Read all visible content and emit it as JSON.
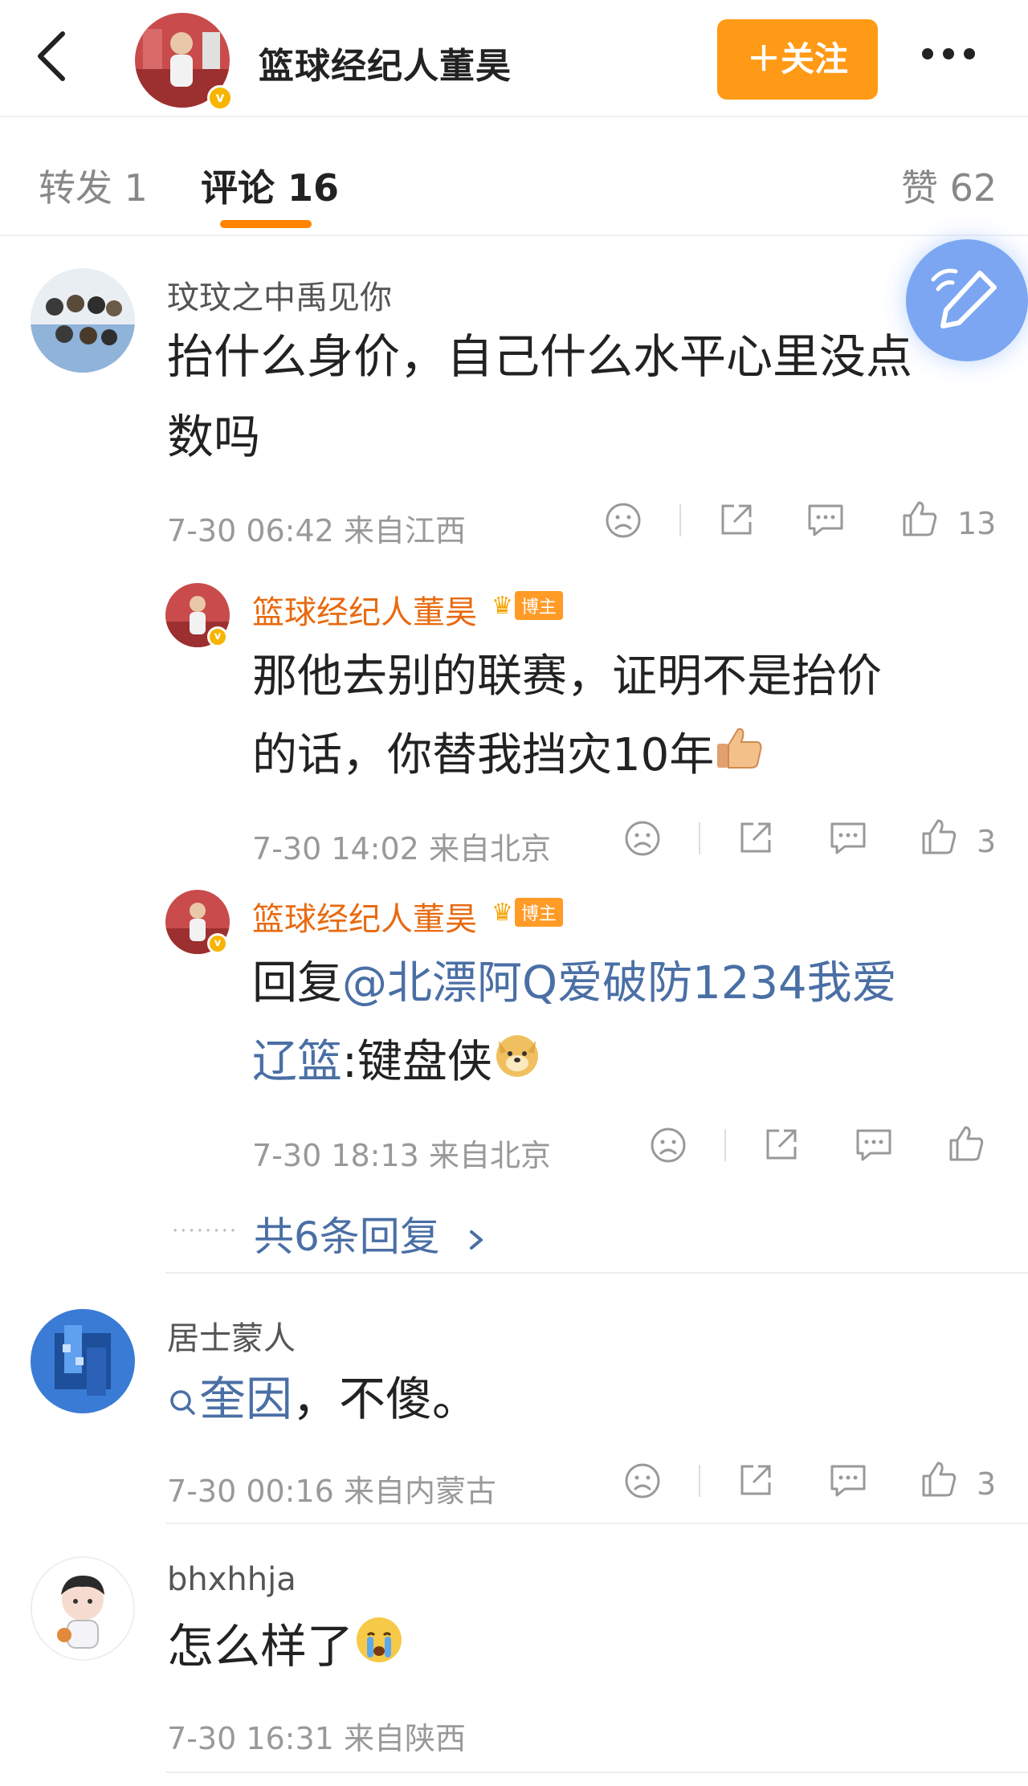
{
  "header": {
    "account_name": "篮球经纪人董昊",
    "follow_label": "＋关注",
    "verified_badge": "v"
  },
  "tabs": [
    {
      "label": "转发 1",
      "active": false
    },
    {
      "label": "评论 16",
      "active": true
    },
    {
      "label": "赞 62",
      "active": false
    }
  ],
  "comments": [
    {
      "author": "玟玟之中禹见你",
      "text": "抬什么身价，自己什么水平心里没点数吗",
      "text_line1": "抬什么身价，自己什么水平心里没点",
      "text_line2": "数吗",
      "time": "7-30 06:42",
      "location": "来自江西",
      "likes": "13"
    },
    {
      "author": "居士蒙人",
      "search_link": "奎因",
      "text_after": "，不傻。",
      "time": "7-30 00:16",
      "location": "来自内蒙古",
      "likes": "3"
    },
    {
      "author": "bhxhhja",
      "text": "怎么样了",
      "time": "7-30 16:31",
      "location": "来自陕西"
    }
  ],
  "replies": [
    {
      "author": "篮球经纪人董昊",
      "badge": "博主",
      "text_line1": "那他去别的联赛，证明不是抬价",
      "text_line2": "的话，你替我挡灾10年",
      "time": "7-30 14:02",
      "location": "来自北京",
      "likes": "3"
    },
    {
      "author": "篮球经纪人董昊",
      "badge": "博主",
      "reply_prefix": "回复",
      "mention_line1": "@北漂阿Q爱破防1234我爱",
      "mention_line2": "辽篮",
      "text_after": ":键盘侠",
      "time": "7-30 18:13",
      "location": "来自北京"
    }
  ],
  "more_replies_label": "共6条回复",
  "colors": {
    "accent_orange": "#ff8200",
    "follow_button": "#ff9a16",
    "link_blue": "#4a6fa5",
    "author_orange": "#e86a10",
    "fab_blue": "#6a9af0"
  },
  "icons": [
    "back-arrow-icon",
    "more-icon",
    "edit-pencil-icon",
    "sad-face-icon",
    "share-icon",
    "comment-icon",
    "like-icon",
    "thumbs-up-emoji",
    "doge-emoji",
    "crying-emoji",
    "search-icon",
    "chevron-right-icon",
    "crown-icon"
  ]
}
